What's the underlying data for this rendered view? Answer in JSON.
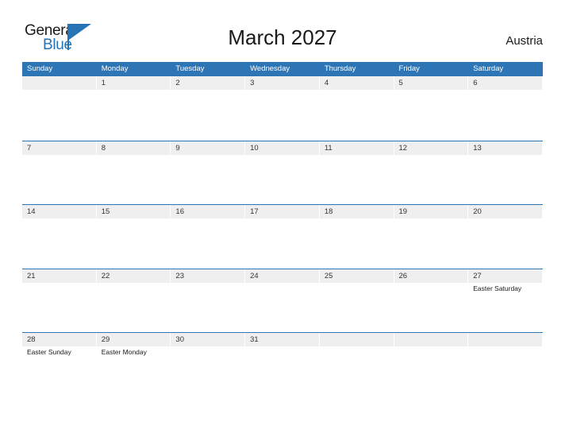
{
  "logo": {
    "text_primary": "General",
    "text_secondary": "Blue",
    "icon": "flag-triangle-icon",
    "color": "#2673b5"
  },
  "header": {
    "title": "March 2027",
    "country": "Austria"
  },
  "theme": {
    "header_blue": "#2e75b6",
    "band_gray": "#efefef",
    "page_background": "#ffffff",
    "text_dark": "#1a1a1a"
  },
  "calendar": {
    "weekdays": [
      "Sunday",
      "Monday",
      "Tuesday",
      "Wednesday",
      "Thursday",
      "Friday",
      "Saturday"
    ],
    "weeks": [
      [
        {
          "day": "",
          "event": ""
        },
        {
          "day": "1",
          "event": ""
        },
        {
          "day": "2",
          "event": ""
        },
        {
          "day": "3",
          "event": ""
        },
        {
          "day": "4",
          "event": ""
        },
        {
          "day": "5",
          "event": ""
        },
        {
          "day": "6",
          "event": ""
        }
      ],
      [
        {
          "day": "7",
          "event": ""
        },
        {
          "day": "8",
          "event": ""
        },
        {
          "day": "9",
          "event": ""
        },
        {
          "day": "10",
          "event": ""
        },
        {
          "day": "11",
          "event": ""
        },
        {
          "day": "12",
          "event": ""
        },
        {
          "day": "13",
          "event": ""
        }
      ],
      [
        {
          "day": "14",
          "event": ""
        },
        {
          "day": "15",
          "event": ""
        },
        {
          "day": "16",
          "event": ""
        },
        {
          "day": "17",
          "event": ""
        },
        {
          "day": "18",
          "event": ""
        },
        {
          "day": "19",
          "event": ""
        },
        {
          "day": "20",
          "event": ""
        }
      ],
      [
        {
          "day": "21",
          "event": ""
        },
        {
          "day": "22",
          "event": ""
        },
        {
          "day": "23",
          "event": ""
        },
        {
          "day": "24",
          "event": ""
        },
        {
          "day": "25",
          "event": ""
        },
        {
          "day": "26",
          "event": ""
        },
        {
          "day": "27",
          "event": "Easter Saturday"
        }
      ],
      [
        {
          "day": "28",
          "event": "Easter Sunday"
        },
        {
          "day": "29",
          "event": "Easter Monday"
        },
        {
          "day": "30",
          "event": ""
        },
        {
          "day": "31",
          "event": ""
        },
        {
          "day": "",
          "event": ""
        },
        {
          "day": "",
          "event": ""
        },
        {
          "day": "",
          "event": ""
        }
      ]
    ]
  }
}
